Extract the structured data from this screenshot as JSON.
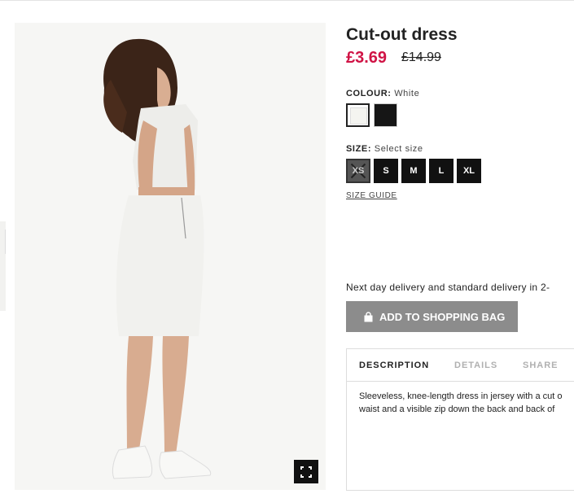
{
  "product": {
    "title": "Cut-out dress",
    "price": "£3.69",
    "old_price": "£14.99"
  },
  "colour": {
    "label": "COLOUR:",
    "value": "White",
    "options": [
      "white",
      "black"
    ]
  },
  "size": {
    "label": "SIZE:",
    "value": "Select size",
    "options": [
      "XS",
      "S",
      "M",
      "L",
      "XL"
    ],
    "guide_label": "SIZE GUIDE"
  },
  "delivery_text": "Next day delivery and standard delivery in 2-",
  "add_button": {
    "label": "ADD TO SHOPPING BAG",
    "icon": "shopping-bag-icon"
  },
  "tabs": [
    "DESCRIPTION",
    "DETAILS",
    "SHARE"
  ],
  "description": {
    "line1": "Sleeveless, knee-length dress in jersey with a cut o",
    "line2": "waist and a visible zip down the back and back of"
  },
  "colors": {
    "price_red": "#d01345",
    "button_grey": "#8c8c8c"
  }
}
